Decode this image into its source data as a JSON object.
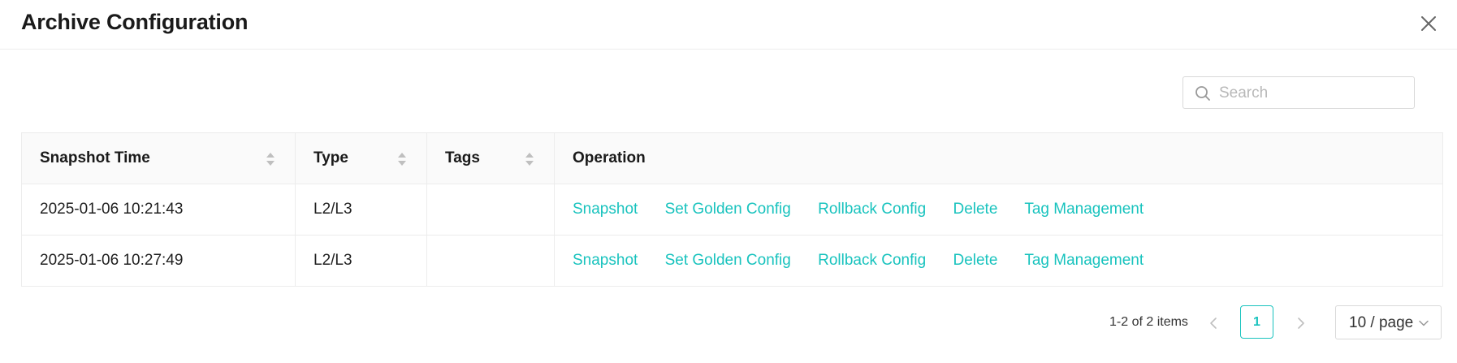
{
  "modal": {
    "title": "Archive Configuration"
  },
  "search": {
    "placeholder": "Search",
    "value": ""
  },
  "table": {
    "columns": [
      "Snapshot Time",
      "Type",
      "Tags",
      "Operation"
    ],
    "rows": [
      {
        "snapshot_time": "2025-01-06 10:21:43",
        "type": "L2/L3",
        "tags": "",
        "operations": [
          "Snapshot",
          "Set Golden Config",
          "Rollback Config",
          "Delete",
          "Tag Management"
        ]
      },
      {
        "snapshot_time": "2025-01-06 10:27:49",
        "type": "L2/L3",
        "tags": "",
        "operations": [
          "Snapshot",
          "Set Golden Config",
          "Rollback Config",
          "Delete",
          "Tag Management"
        ]
      }
    ]
  },
  "pagination": {
    "total_text": "1-2 of 2 items",
    "current_page": "1",
    "page_size": "10 / page"
  },
  "colors": {
    "accent": "#19c3be",
    "border": "#ececec",
    "header_bg": "#fafafa"
  },
  "icons": {
    "close": "close-icon",
    "search": "search-icon",
    "sort": "sort-icon",
    "prev": "chevron-left-icon",
    "next": "chevron-right-icon",
    "dropdown": "chevron-down-icon"
  }
}
